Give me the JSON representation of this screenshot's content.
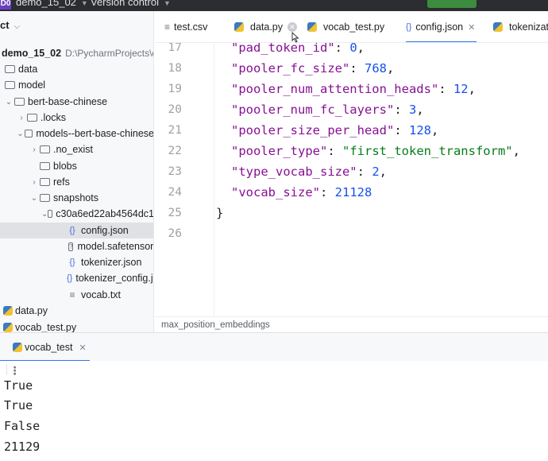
{
  "titlebar": {
    "project_badge": "D0",
    "project_name": "demo_15_02",
    "version_control": "Version control"
  },
  "project_panel": {
    "header": "ct",
    "root": {
      "name": "demo_15_02",
      "path": "D:\\PycharmProjects\\de"
    },
    "items": [
      {
        "label": "data",
        "type": "folder"
      },
      {
        "label": "model",
        "type": "folder"
      },
      {
        "label": "bert-base-chinese",
        "type": "folder"
      },
      {
        "label": ".locks",
        "type": "folder"
      },
      {
        "label": "models--bert-base-chinese",
        "type": "folder"
      },
      {
        "label": ".no_exist",
        "type": "folder"
      },
      {
        "label": "blobs",
        "type": "folder"
      },
      {
        "label": "refs",
        "type": "folder"
      },
      {
        "label": "snapshots",
        "type": "folder"
      },
      {
        "label": "c30a6ed22ab4564dc1",
        "type": "folder"
      },
      {
        "label": "config.json",
        "type": "json",
        "selected": true
      },
      {
        "label": "model.safetensors",
        "type": "unknown"
      },
      {
        "label": "tokenizer.json",
        "type": "json"
      },
      {
        "label": "tokenizer_config.js",
        "type": "json"
      },
      {
        "label": "vocab.txt",
        "type": "text"
      },
      {
        "label": "data.py",
        "type": "python"
      },
      {
        "label": "vocab_test.py",
        "type": "python"
      }
    ]
  },
  "tabs": [
    {
      "label": "test.csv",
      "icon": "lines-icon"
    },
    {
      "label": "data.py",
      "icon": "python-icon"
    },
    {
      "label": "vocab_test.py",
      "icon": "python-icon"
    },
    {
      "label": "config.json",
      "icon": "json-icon",
      "active": true
    },
    {
      "label": "tokenizatio",
      "icon": "python-icon"
    }
  ],
  "editor": {
    "lines": [
      {
        "num": "17",
        "key": "\"pad_token_id\"",
        "value": "0",
        "value_type": "number",
        "comma": true
      },
      {
        "num": "18",
        "key": "\"pooler_fc_size\"",
        "value": "768",
        "value_type": "number",
        "comma": true
      },
      {
        "num": "19",
        "key": "\"pooler_num_attention_heads\"",
        "value": "12",
        "value_type": "number",
        "comma": true
      },
      {
        "num": "20",
        "key": "\"pooler_num_fc_layers\"",
        "value": "3",
        "value_type": "number",
        "comma": true
      },
      {
        "num": "21",
        "key": "\"pooler_size_per_head\"",
        "value": "128",
        "value_type": "number",
        "comma": true
      },
      {
        "num": "22",
        "key": "\"pooler_type\"",
        "value": "\"first_token_transform\"",
        "value_type": "string",
        "comma": true
      },
      {
        "num": "23",
        "key": "\"type_vocab_size\"",
        "value": "2",
        "value_type": "number",
        "comma": true
      },
      {
        "num": "24",
        "key": "\"vocab_size\"",
        "value": "21128",
        "value_type": "number",
        "comma": false
      },
      {
        "num": "25",
        "brace": "}"
      },
      {
        "num": "26"
      }
    ]
  },
  "breadcrumb": "max_position_embeddings",
  "run_panel": {
    "tab_label": "vocab_test",
    "output": [
      "True",
      "True",
      "False",
      "21129"
    ]
  },
  "colors": {
    "key": "#871094",
    "number": "#1750eb",
    "string": "#067d17",
    "accent": "#3574f0"
  }
}
